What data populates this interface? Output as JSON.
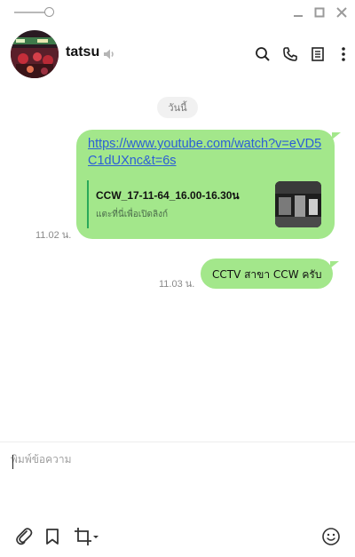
{
  "window": {
    "slider_icon": "zoom-slider",
    "controls": [
      "minimize-icon",
      "maximize-icon",
      "close-icon"
    ]
  },
  "header": {
    "contact_name": "tatsu",
    "icons": [
      "speaker-muted-icon",
      "search-icon",
      "phone-icon",
      "notes-icon",
      "more-vertical-icon"
    ]
  },
  "chat": {
    "date_label": "วันนี้",
    "messages": [
      {
        "link": "https://www.youtube.com/watch?v=eVD5C1dUXnc&t=6s",
        "preview_title": "CCW_17-11-64_16.00-16.30น",
        "preview_subtitle": "แตะที่นี่เพื่อเปิดลิงก์",
        "time": "11.02 น."
      },
      {
        "text": "CCTV สาขา CCW ครับ",
        "time": "11.03 น."
      }
    ]
  },
  "composer": {
    "placeholder": "พิมพ์ข้อความ",
    "tools": [
      "attach-icon",
      "bookmark-icon",
      "crop-icon",
      "emoji-icon"
    ]
  },
  "colors": {
    "bubble": "#a3e78b",
    "link": "#2b5ed6",
    "accent_bar": "#2aa85a"
  }
}
